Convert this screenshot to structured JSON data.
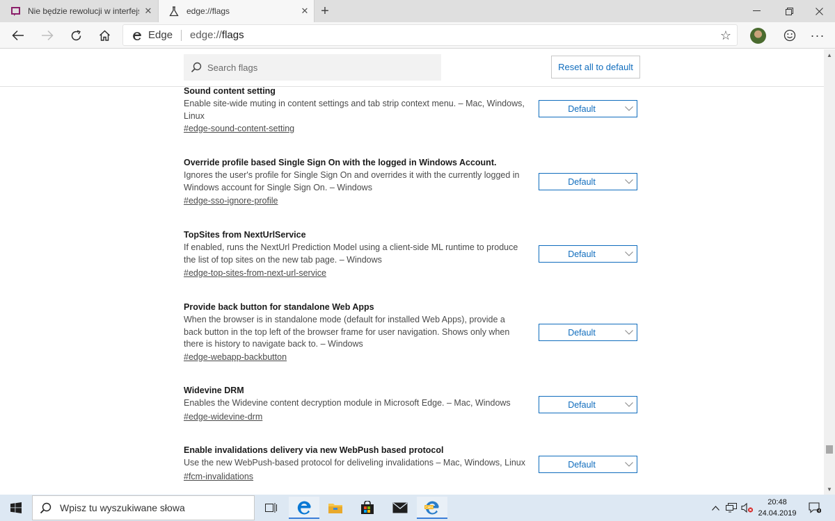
{
  "tabs": [
    {
      "title": "Nie będzie rewolucji w interfejsie",
      "close": "✕",
      "favicon": "purple-chat-icon"
    },
    {
      "title": "edge://flags",
      "close": "✕",
      "favicon": "flask-icon"
    }
  ],
  "new_tab": "+",
  "window_controls": {
    "minimize": "—",
    "restore": "❐",
    "close": "✕"
  },
  "toolbar": {
    "brand": "Edge",
    "url_scheme": "edge://",
    "url_path": "flags",
    "favorite": "☆",
    "more": "···"
  },
  "page": {
    "search_placeholder": "Search flags",
    "reset_label": "Reset all to default"
  },
  "flags": [
    {
      "name": "Sound content setting",
      "description": "Enable site-wide muting in content settings and tab strip context menu. – Mac, Windows, Linux",
      "anchor": "#edge-sound-content-setting",
      "value": "Default"
    },
    {
      "name": "Override profile based Single Sign On with the logged in Windows Account.",
      "description": "Ignores the user's profile for Single Sign On and overrides it with the currently logged in Windows account for Single Sign On. – Windows",
      "anchor": "#edge-sso-ignore-profile",
      "value": "Default"
    },
    {
      "name": "TopSites from NextUrlService",
      "description": "If enabled, runs the NextUrl Prediction Model using a client-side ML runtime to produce the list of top sites on the new tab page. – Windows",
      "anchor": "#edge-top-sites-from-next-url-service",
      "value": "Default"
    },
    {
      "name": "Provide back button for standalone Web Apps",
      "description": "When the browser is in standalone mode (default for installed Web Apps), provide a back button in the top left of the browser frame for user navigation. Shows only when there is history to navigate back to. – Windows",
      "anchor": "#edge-webapp-backbutton",
      "value": "Default"
    },
    {
      "name": "Widevine DRM",
      "description": "Enables the Widevine content decryption module in Microsoft Edge. – Mac, Windows",
      "anchor": "#edge-widevine-drm",
      "value": "Default"
    },
    {
      "name": "Enable invalidations delivery via new WebPush based protocol",
      "description": "Use the new WebPush-based protocol for deliveling invalidations – Mac, Windows, Linux",
      "anchor": "#fcm-invalidations",
      "value": "Default"
    }
  ],
  "taskbar": {
    "search_placeholder": "Wpisz tu wyszukiwane słowa",
    "pinned": [
      "task-view-icon",
      "edge-icon",
      "file-explorer-icon",
      "store-icon",
      "mail-icon",
      "edge-canary-icon"
    ],
    "time": "20:48",
    "date": "24.04.2019"
  },
  "colors": {
    "accent": "#0f6cbd",
    "tabstrip": "#dfdfdf",
    "taskbar": "#dde8f3"
  }
}
